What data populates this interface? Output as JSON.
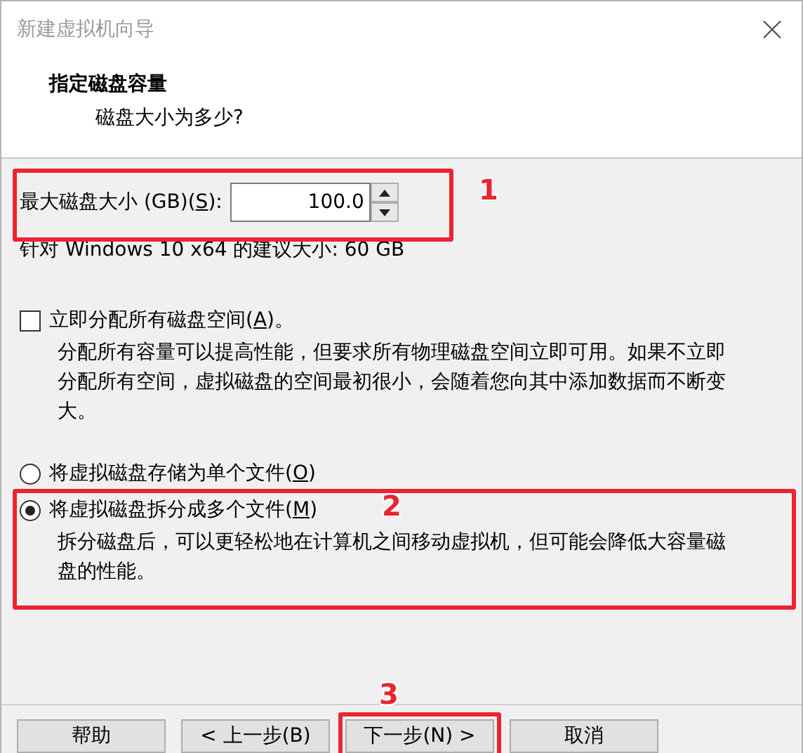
{
  "window": {
    "title": "新建虚拟机向导"
  },
  "header": {
    "title": "指定磁盘容量",
    "subtitle": "磁盘大小为多少?"
  },
  "disk_size": {
    "label": "最大磁盘大小 (GB)(",
    "access_key": "S",
    "label_end": "):",
    "value": "100.0",
    "annotation": "1"
  },
  "recommendation": "针对 Windows 10 x64 的建议大小: 60 GB",
  "allocate": {
    "label": "立即分配所有磁盘空间(",
    "access_key": "A",
    "label_end": ")。",
    "checked": false,
    "description": "分配所有容量可以提高性能，但要求所有物理磁盘空间立即可用。如果不立即分配所有空间，虚拟磁盘的空间最初很小，会随着您向其中添加数据而不断变大。"
  },
  "storage_options": [
    {
      "label": "将虚拟磁盘存储为单个文件(",
      "access_key": "O",
      "label_end": ")",
      "selected": false
    },
    {
      "label": "将虚拟磁盘拆分成多个文件(",
      "access_key": "M",
      "label_end": ")",
      "selected": true,
      "description": "拆分磁盘后，可以更轻松地在计算机之间移动虚拟机，但可能会降低大容量磁盘的性能。",
      "annotation": "2"
    }
  ],
  "buttons": [
    {
      "label": "帮助"
    },
    {
      "label": "< 上一步(B)"
    },
    {
      "label": "下一步(N) >",
      "annotation": "3"
    },
    {
      "label": "取消"
    }
  ]
}
